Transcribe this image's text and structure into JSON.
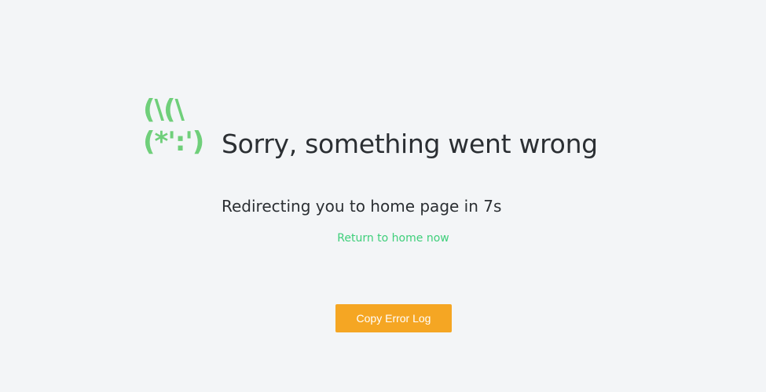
{
  "error": {
    "mascot": "(\\(\\\n(*':')",
    "title": "Sorry, something went wrong",
    "redirect_text": "Redirecting you to home page in 7s",
    "home_link_label": "Return to home now",
    "copy_button_label": "Copy Error Log"
  },
  "colors": {
    "background": "#f3f5f7",
    "accent_green": "#3ecf7a",
    "mascot_green": "#6fcf7a",
    "button_orange": "#f5a623",
    "text_dark": "#2b2f33"
  }
}
